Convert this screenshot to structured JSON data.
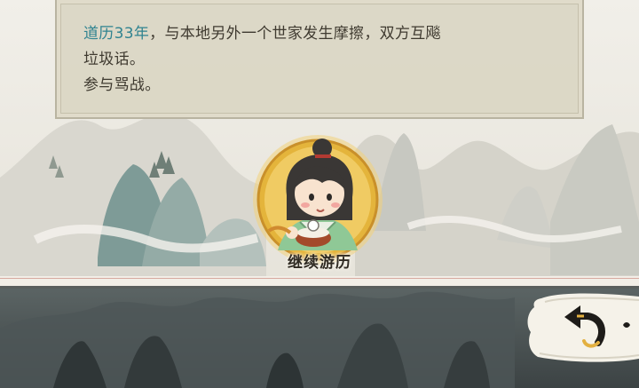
{
  "event": {
    "year_text": "道历33年",
    "line1_rest": "，与本地另外一个世家发生摩擦，双方互飚",
    "line2": "垃圾话。",
    "line3": "参与骂战。",
    "year_color": "#2f8390",
    "text_color": "#3f3a30"
  },
  "continue_button": {
    "label": "继续游历",
    "icon": "character-portrait-icon"
  },
  "back_button": {
    "icon": "back-arrow-icon"
  },
  "colors": {
    "panel_bg": "#dad6c4",
    "panel_border": "#b9b4a1",
    "portrait_ring": "#e4b43b",
    "divider_red": "#d7a9a0",
    "bottom_bg": "#4a5253"
  }
}
